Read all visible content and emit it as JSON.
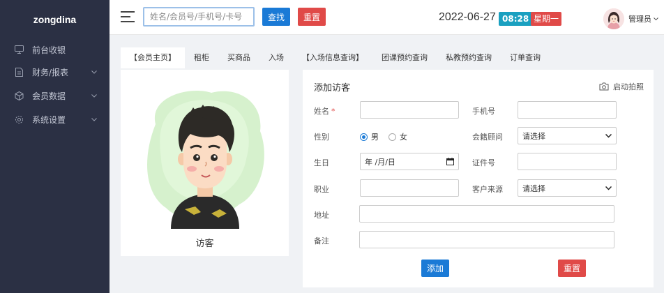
{
  "sidebar": {
    "brand": "zongdina",
    "items": [
      {
        "label": "前台收银",
        "icon": "monitor-icon"
      },
      {
        "label": "财务/报表",
        "icon": "document-icon"
      },
      {
        "label": "会员数据",
        "icon": "cube-icon"
      },
      {
        "label": "系统设置",
        "icon": "gear-icon"
      }
    ]
  },
  "header": {
    "search_placeholder": "姓名/会员号/手机号/卡号",
    "find_label": "查找",
    "reset_label": "重置",
    "date": "2022-06-27",
    "time": "08:28",
    "weekday": "星期一",
    "user": "管理员"
  },
  "tabs": [
    {
      "label": "【会员主页】",
      "active": true
    },
    {
      "label": "租柜"
    },
    {
      "label": "买商品"
    },
    {
      "label": "入场"
    },
    {
      "label": "【入场信息查询】"
    },
    {
      "label": "团课预约查询"
    },
    {
      "label": "私教预约查询"
    },
    {
      "label": "订单查询"
    }
  ],
  "visitor": {
    "label": "访客"
  },
  "form": {
    "title": "添加访客",
    "camera_label": "启动拍照",
    "fields": {
      "name": "姓名",
      "phone": "手机号",
      "gender": "性别",
      "male": "男",
      "female": "女",
      "consultant": "会籍顾问",
      "consultant_value": "请选择",
      "birthday": "生日",
      "birthday_value": "年 /月/日",
      "id_number": "证件号",
      "occupation": "职业",
      "source": "客户来源",
      "source_value": "请选择",
      "address": "地址",
      "notes": "备注"
    },
    "add_label": "添加",
    "reset_label": "重置"
  },
  "colors": {
    "sidebar_bg": "#2b3044",
    "primary": "#1a7ad6",
    "danger": "#e04a48",
    "time_badge": "#1aa0c0"
  }
}
